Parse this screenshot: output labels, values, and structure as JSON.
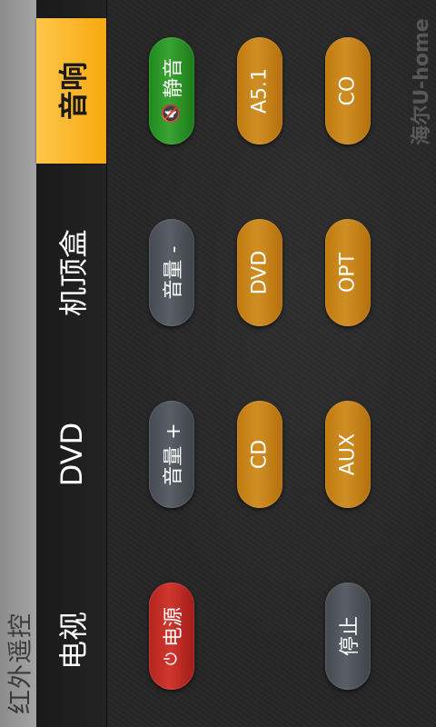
{
  "app": {
    "title": "红外遥控"
  },
  "tabs": [
    {
      "label": "电视",
      "active": false
    },
    {
      "label": "DVD",
      "active": false
    },
    {
      "label": "机顶盒",
      "active": false
    },
    {
      "label": "音响",
      "active": true
    }
  ],
  "buttons": {
    "power": {
      "label": "电源",
      "icon": "power-icon",
      "color": "#c62a24"
    },
    "volume_up": {
      "label": "音量 +",
      "color": "#50555d"
    },
    "volume_down": {
      "label": "音量 -",
      "color": "#50555d"
    },
    "mute": {
      "label": "静音",
      "icon": "speaker-mute-icon",
      "color": "#2f9a2a"
    },
    "stop": {
      "label": "停止",
      "color": "#50555d"
    },
    "cd": {
      "label": "CD",
      "color": "#c88418"
    },
    "dvd": {
      "label": "DVD",
      "color": "#c88418"
    },
    "a51": {
      "label": "A5.1",
      "color": "#c88418"
    },
    "aux": {
      "label": "AUX",
      "color": "#c88418"
    },
    "opt": {
      "label": "OPT",
      "color": "#c88418"
    },
    "co": {
      "label": "CO",
      "color": "#c88418"
    }
  },
  "watermark": {
    "text": "海尔U-home"
  },
  "colors": {
    "active_tab": "#f7a90f",
    "title_bar": "#9a9a9a"
  }
}
